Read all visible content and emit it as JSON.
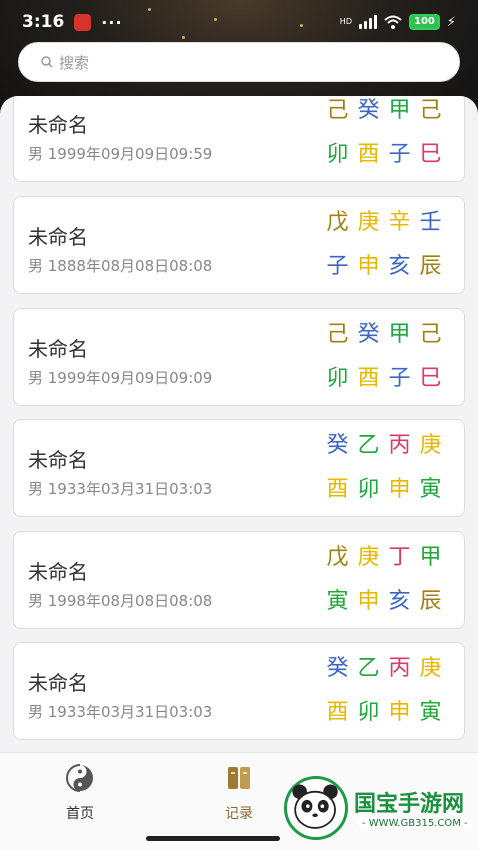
{
  "status": {
    "time": "3:16",
    "more": "···",
    "network": "HD",
    "battery": "100",
    "bolt": "⚡"
  },
  "search": {
    "placeholder": "搜索"
  },
  "records": [
    {
      "name": "未命名",
      "info": "男 1999年09月09日09:59",
      "pillars": [
        [
          "己",
          "#a08010"
        ],
        [
          "癸",
          "#3a66c8"
        ],
        [
          "甲",
          "#1fa83a"
        ],
        [
          "己",
          "#a08010"
        ],
        [
          "卯",
          "#1fa83a"
        ],
        [
          "酉",
          "#e8b800"
        ],
        [
          "子",
          "#3a66c8"
        ],
        [
          "巳",
          "#d83a6a"
        ]
      ]
    },
    {
      "name": "未命名",
      "info": "男 1888年08月08日08:08",
      "pillars": [
        [
          "戊",
          "#a08010"
        ],
        [
          "庚",
          "#e8b800"
        ],
        [
          "辛",
          "#e8b800"
        ],
        [
          "壬",
          "#3a66c8"
        ],
        [
          "子",
          "#3a66c8"
        ],
        [
          "申",
          "#e8b800"
        ],
        [
          "亥",
          "#3a66c8"
        ],
        [
          "辰",
          "#a08010"
        ]
      ]
    },
    {
      "name": "未命名",
      "info": "男 1999年09月09日09:09",
      "pillars": [
        [
          "己",
          "#a08010"
        ],
        [
          "癸",
          "#3a66c8"
        ],
        [
          "甲",
          "#1fa83a"
        ],
        [
          "己",
          "#a08010"
        ],
        [
          "卯",
          "#1fa83a"
        ],
        [
          "酉",
          "#e8b800"
        ],
        [
          "子",
          "#3a66c8"
        ],
        [
          "巳",
          "#d83a6a"
        ]
      ]
    },
    {
      "name": "未命名",
      "info": "男 1933年03月31日03:03",
      "pillars": [
        [
          "癸",
          "#3a66c8"
        ],
        [
          "乙",
          "#1fa83a"
        ],
        [
          "丙",
          "#d83a6a"
        ],
        [
          "庚",
          "#e8b800"
        ],
        [
          "酉",
          "#e8b800"
        ],
        [
          "卯",
          "#1fa83a"
        ],
        [
          "申",
          "#e8b800"
        ],
        [
          "寅",
          "#1fa83a"
        ]
      ]
    },
    {
      "name": "未命名",
      "info": "男 1998年08月08日08:08",
      "pillars": [
        [
          "戊",
          "#a08010"
        ],
        [
          "庚",
          "#e8b800"
        ],
        [
          "丁",
          "#d83a6a"
        ],
        [
          "甲",
          "#1fa83a"
        ],
        [
          "寅",
          "#1fa83a"
        ],
        [
          "申",
          "#e8b800"
        ],
        [
          "亥",
          "#3a66c8"
        ],
        [
          "辰",
          "#a08010"
        ]
      ]
    },
    {
      "name": "未命名",
      "info": "男 1933年03月31日03:03",
      "pillars": [
        [
          "癸",
          "#3a66c8"
        ],
        [
          "乙",
          "#1fa83a"
        ],
        [
          "丙",
          "#d83a6a"
        ],
        [
          "庚",
          "#e8b800"
        ],
        [
          "酉",
          "#e8b800"
        ],
        [
          "卯",
          "#1fa83a"
        ],
        [
          "申",
          "#e8b800"
        ],
        [
          "寅",
          "#1fa83a"
        ]
      ]
    }
  ],
  "tabs": {
    "home": "首页",
    "records": "记录"
  },
  "watermark": {
    "title": "国宝手游网",
    "url": "- WWW.GB315.COM -"
  },
  "colors": {
    "wood": "#1fa83a",
    "fire": "#d83a6a",
    "earth": "#a08010",
    "metal": "#e8b800",
    "water": "#3a66c8",
    "accent_tab": "#a07a30"
  }
}
